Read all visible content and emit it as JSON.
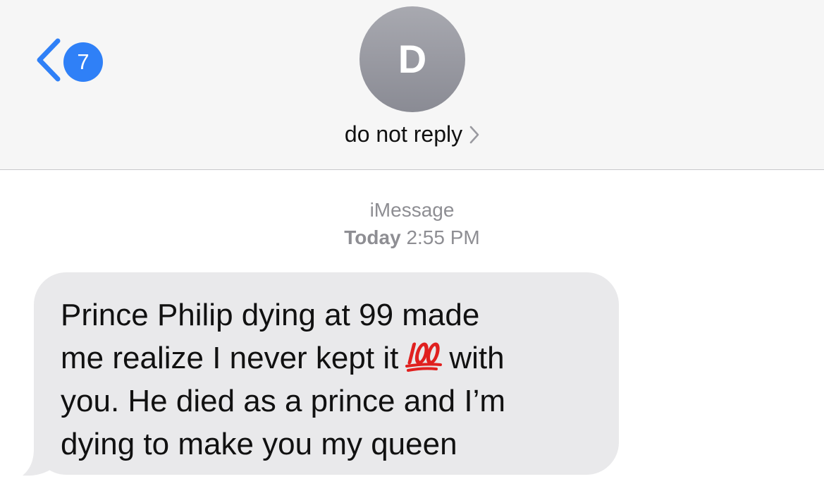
{
  "header": {
    "back_badge_count": "7",
    "avatar_initial": "D",
    "contact_name": "do not reply"
  },
  "conversation": {
    "service": "iMessage",
    "timestamp_day": "Today",
    "timestamp_time": "2:55 PM"
  },
  "message": {
    "line1": "Prince Philip dying at 99 made",
    "line2_before_emoji": "me realize I never kept it",
    "emoji": "100-emoji",
    "line2_after_emoji": "with",
    "line3": "you. He died as a prince and I’m",
    "line4": "dying to make you my queen"
  },
  "colors": {
    "accent_blue": "#2f80f7",
    "header_bg": "#f6f6f6",
    "bubble_bg": "#e9e9eb",
    "emoji_red": "#e0201f"
  },
  "icons": {
    "back": "chevron-left-icon",
    "contact_details": "chevron-right-icon",
    "hundred_points": "hundred-points-emoji-icon"
  }
}
